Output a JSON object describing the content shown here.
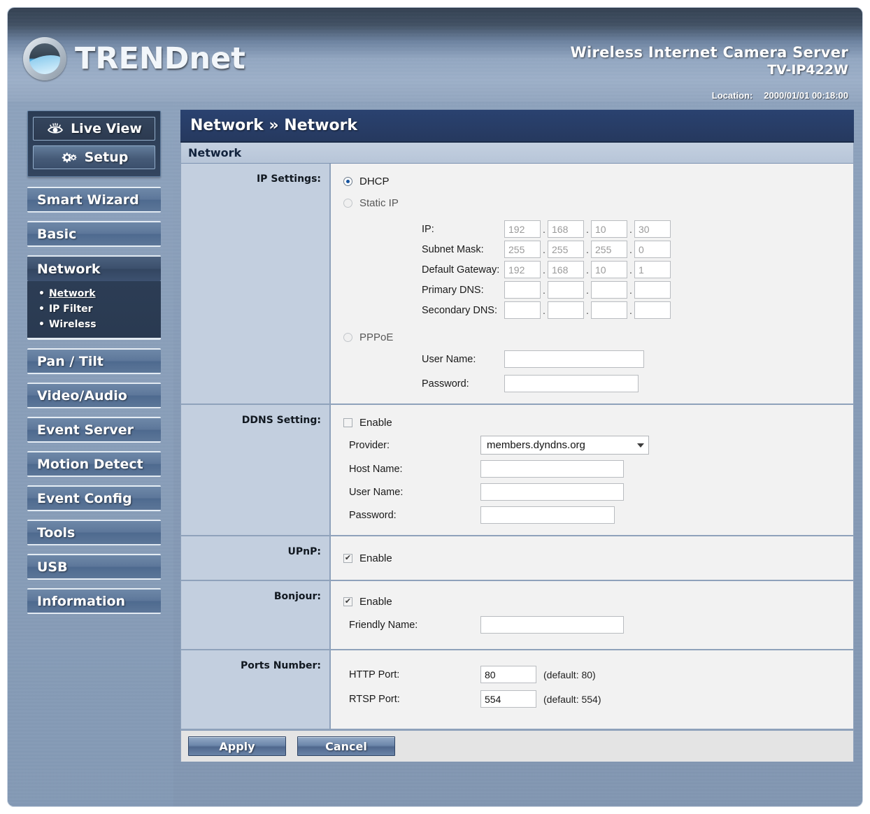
{
  "header": {
    "brand": "TRENDNET",
    "brand_upper": "TREND",
    "brand_lower": "net",
    "product_title": "Wireless Internet Camera Server",
    "product_model": "TV-IP422W",
    "location_label": "Location:",
    "location_value": "2000/01/01 00:18:00"
  },
  "sidebar": {
    "top_buttons": [
      {
        "label": "Live View",
        "icon": "eye-icon",
        "active": false
      },
      {
        "label": "Setup",
        "icon": "gear-icon",
        "active": true
      }
    ],
    "items": [
      {
        "label": "Smart Wizard"
      },
      {
        "label": "Basic"
      },
      {
        "label": "Network",
        "active": true,
        "submenu": [
          {
            "label": "Network",
            "active": true
          },
          {
            "label": "IP Filter",
            "active": false
          },
          {
            "label": "Wireless",
            "active": false
          }
        ]
      },
      {
        "label": "Pan / Tilt"
      },
      {
        "label": "Video/Audio"
      },
      {
        "label": "Event Server"
      },
      {
        "label": "Motion Detect"
      },
      {
        "label": "Event Config"
      },
      {
        "label": "Tools"
      },
      {
        "label": "USB"
      },
      {
        "label": "Information"
      }
    ]
  },
  "main": {
    "breadcrumb": "Network » Network",
    "panel_title": "Network",
    "ip_settings": {
      "label": "IP Settings:",
      "dhcp_label": "DHCP",
      "dhcp_selected": true,
      "static_label": "Static IP",
      "static_selected": false,
      "pppoe_label": "PPPoE",
      "pppoe_selected": false,
      "ip_label": "IP:",
      "ip_value": [
        "192",
        "168",
        "10",
        "30"
      ],
      "subnet_label": "Subnet Mask:",
      "subnet_value": [
        "255",
        "255",
        "255",
        "0"
      ],
      "gateway_label": "Default Gateway:",
      "gateway_value": [
        "192",
        "168",
        "10",
        "1"
      ],
      "primary_dns_label": "Primary DNS:",
      "primary_dns_value": [
        "",
        "",
        "",
        ""
      ],
      "secondary_dns_label": "Secondary DNS:",
      "secondary_dns_value": [
        "",
        "",
        "",
        ""
      ],
      "pppoe_user_label": "User Name:",
      "pppoe_user_value": "",
      "pppoe_pass_label": "Password:",
      "pppoe_pass_value": ""
    },
    "ddns": {
      "label": "DDNS Setting:",
      "enable_label": "Enable",
      "enabled": false,
      "provider_label": "Provider:",
      "provider_value": "members.dyndns.org",
      "host_label": "Host Name:",
      "host_value": "",
      "user_label": "User Name:",
      "user_value": "",
      "pass_label": "Password:",
      "pass_value": ""
    },
    "upnp": {
      "label": "UPnP:",
      "enable_label": "Enable",
      "enabled": true
    },
    "bonjour": {
      "label": "Bonjour:",
      "enable_label": "Enable",
      "enabled": true,
      "friendly_label": "Friendly Name:",
      "friendly_value": ""
    },
    "ports": {
      "label": "Ports Number:",
      "http_label": "HTTP Port:",
      "http_value": "80",
      "http_hint": "(default: 80)",
      "rtsp_label": "RTSP Port:",
      "rtsp_value": "554",
      "rtsp_hint": "(default: 554)"
    },
    "buttons": {
      "apply": "Apply",
      "cancel": "Cancel"
    }
  },
  "colors": {
    "header_dark": "#2e3c4e",
    "breadcrumb": "#26395f",
    "label_col": "#c3cfdf",
    "panel_bg": "#f2f2f2",
    "accent": "#15539e"
  }
}
